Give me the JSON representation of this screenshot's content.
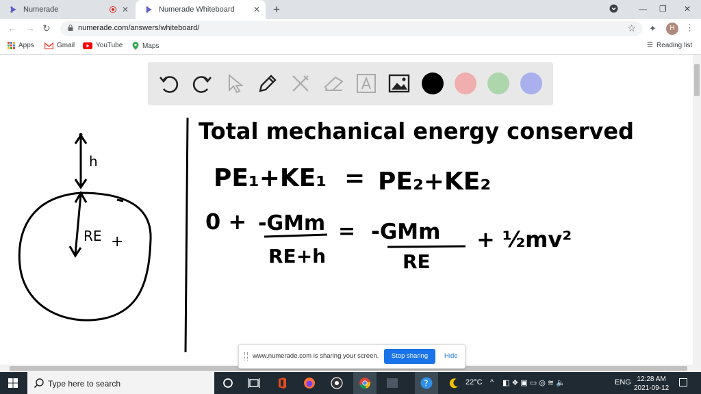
{
  "browser": {
    "tabs": [
      {
        "title": "Numerade",
        "icon": "numerade-logo-icon"
      },
      {
        "title": "Numerade Whiteboard",
        "icon": "numerade-logo-icon"
      }
    ],
    "new_tab": "+",
    "url": "numerade.com/answers/whiteboard/",
    "profile_initial": "H",
    "bookmarks": [
      {
        "label": "Apps",
        "icon": "apps-grid-icon"
      },
      {
        "label": "Gmail",
        "icon": "gmail-icon"
      },
      {
        "label": "YouTube",
        "icon": "youtube-icon"
      },
      {
        "label": "Maps",
        "icon": "maps-icon"
      }
    ],
    "reading_list": "Reading list"
  },
  "whiteboard": {
    "tools": [
      "undo-icon",
      "redo-icon",
      "pointer-icon",
      "pen-icon",
      "tools-icon",
      "eraser-icon",
      "text-icon",
      "image-icon"
    ],
    "colors": [
      "#000000",
      "#f0aeae",
      "#add6ad",
      "#aab0ee"
    ],
    "board_text": {
      "line1": "Total mechanical energy conserved",
      "line2_left": "PE₁+KE₁",
      "line2_eq": "=",
      "line2_right": "PE₂+KE₂",
      "line3_lead": "0 +",
      "frac1_num": "-GMm",
      "frac1_den": "RE+h",
      "eq2": "=",
      "frac2_num": "-GMm",
      "frac2_den": "RE",
      "tail": "+ ½mv²",
      "label_h": "h",
      "label_re": "RE",
      "center": "+"
    }
  },
  "share_banner": {
    "message": "www.numerade.com is sharing your screen.",
    "stop": "Stop sharing",
    "hide": "Hide"
  },
  "taskbar": {
    "search_placeholder": "Type here to search",
    "temperature": "22°C",
    "language": "ENG",
    "time": "12:28 AM",
    "date": "2021-09-12"
  }
}
